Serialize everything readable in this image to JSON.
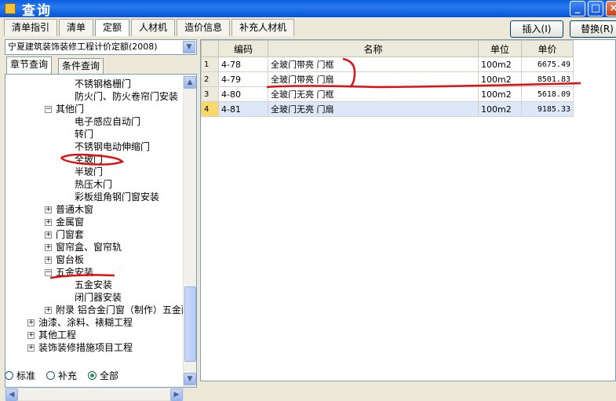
{
  "window": {
    "title": "查询",
    "min_glyph": "_",
    "max_glyph": "□",
    "close_glyph": "×"
  },
  "tabs": [
    "清单指引",
    "清单",
    "定额",
    "人材机",
    "造价信息",
    "补充人材机"
  ],
  "active_tab": 2,
  "buttons": {
    "insert": "插入(I)",
    "replace": "替换(R)"
  },
  "quota_library": "宁夏建筑装饰装修工程计价定额(2008)",
  "search_tabs": [
    "章节查询",
    "条件查询"
  ],
  "tree": [
    {
      "label": "不锈钢格栅门",
      "level": 3,
      "exp": ""
    },
    {
      "label": "防火门、防火卷帘门安装",
      "level": 3,
      "exp": ""
    },
    {
      "label": "其他门",
      "level": 2,
      "exp": "−"
    },
    {
      "label": "电子感应自动门",
      "level": 3,
      "exp": ""
    },
    {
      "label": "转门",
      "level": 3,
      "exp": ""
    },
    {
      "label": "不锈钢电动伸缩门",
      "level": 3,
      "exp": ""
    },
    {
      "label": "全玻门",
      "level": 3,
      "exp": ""
    },
    {
      "label": "半玻门",
      "level": 3,
      "exp": ""
    },
    {
      "label": "热压木门",
      "level": 3,
      "exp": ""
    },
    {
      "label": "彩板组角钢门窗安装",
      "level": 3,
      "exp": ""
    },
    {
      "label": "普通木窗",
      "level": 2,
      "exp": "+"
    },
    {
      "label": "金属窗",
      "level": 2,
      "exp": "+"
    },
    {
      "label": "门窗套",
      "level": 2,
      "exp": "+"
    },
    {
      "label": "窗帘盒、窗帘轨",
      "level": 2,
      "exp": "+"
    },
    {
      "label": "窗台板",
      "level": 2,
      "exp": "+"
    },
    {
      "label": "五金安装",
      "level": 2,
      "exp": "−"
    },
    {
      "label": "五金安装",
      "level": 3,
      "exp": ""
    },
    {
      "label": "闭门器安装",
      "level": 3,
      "exp": ""
    },
    {
      "label": "附录 铝合金门窗（制作）五金配件",
      "level": 2,
      "exp": "+"
    },
    {
      "label": "油漆、涂料、裱糊工程",
      "level": 1,
      "exp": "+"
    },
    {
      "label": "其他工程",
      "level": 1,
      "exp": "+"
    },
    {
      "label": "装饰装修措施项目工程",
      "level": 1,
      "exp": "+"
    }
  ],
  "radio_options": [
    "标准",
    "补充",
    "全部"
  ],
  "radio_selected": 2,
  "table": {
    "headers": [
      "编码",
      "名称",
      "单位",
      "单价"
    ],
    "rows": [
      {
        "no": "1",
        "code": "4-78",
        "name": "全玻门带亮  门框",
        "unit": "100m2",
        "price": "6675.49"
      },
      {
        "no": "2",
        "code": "4-79",
        "name": "全玻门带亮  门扇",
        "unit": "100m2",
        "price": "8501.83"
      },
      {
        "no": "3",
        "code": "4-80",
        "name": "全玻门无亮  门框",
        "unit": "100m2",
        "price": "5618.09"
      },
      {
        "no": "4",
        "code": "4-81",
        "name": "全玻门无亮  门扇",
        "unit": "100m2",
        "price": "9185.33"
      }
    ],
    "selected_row": 3
  },
  "annotation_color": "#e01010"
}
